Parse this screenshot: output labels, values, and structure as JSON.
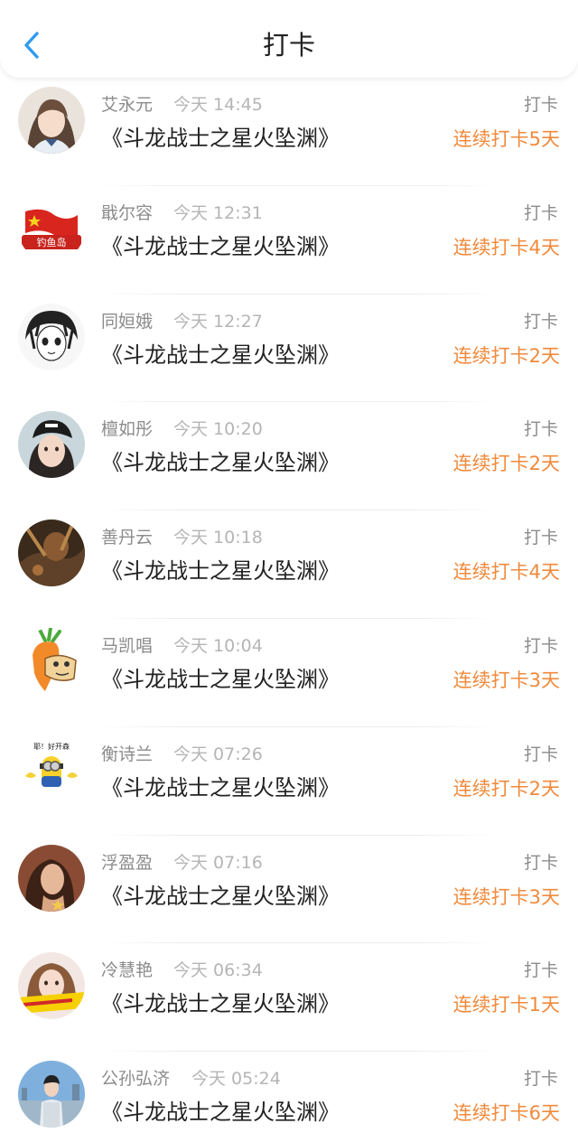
{
  "header": {
    "title": "打卡",
    "back_icon": "chevron-left-icon"
  },
  "colors": {
    "accent": "#2f9bf0",
    "streak": "#f08a3c",
    "muted": "#8c8c8c"
  },
  "checkins": [
    {
      "name": "艾永元",
      "time": "今天 14:45",
      "book": "《斗龙战士之星火坠渊》",
      "action": "打卡",
      "streak": "连续打卡5天",
      "avatar": "girl-portrait-avatar"
    },
    {
      "name": "戢尔容",
      "time": "今天 12:31",
      "book": "《斗龙战士之星火坠渊》",
      "action": "打卡",
      "streak": "连续打卡4天",
      "avatar": "flag-avatar",
      "avatar_text": "钓鱼岛"
    },
    {
      "name": "同姮娥",
      "time": "今天 12:27",
      "book": "《斗龙战士之星火坠渊》",
      "action": "打卡",
      "streak": "连续打卡2天",
      "avatar": "manga-avatar"
    },
    {
      "name": "檀如彤",
      "time": "今天 10:20",
      "book": "《斗龙战士之星火坠渊》",
      "action": "打卡",
      "streak": "连续打卡2天",
      "avatar": "girl-cap-avatar"
    },
    {
      "name": "善丹云",
      "time": "今天 10:18",
      "book": "《斗龙战士之星火坠渊》",
      "action": "打卡",
      "streak": "连续打卡4天",
      "avatar": "dark-scene-avatar"
    },
    {
      "name": "马凯唱",
      "time": "今天 10:04",
      "book": "《斗龙战士之星火坠渊》",
      "action": "打卡",
      "streak": "连续打卡3天",
      "avatar": "carrot-cartoon-avatar"
    },
    {
      "name": "衡诗兰",
      "time": "今天 07:26",
      "book": "《斗龙战士之星火坠渊》",
      "action": "打卡",
      "streak": "连续打卡2天",
      "avatar": "minion-avatar",
      "avatar_text": "耶！好开森"
    },
    {
      "name": "浮盈盈",
      "time": "今天 07:16",
      "book": "《斗龙战士之星火坠渊》",
      "action": "打卡",
      "streak": "连续打卡3天",
      "avatar": "woman-star-avatar"
    },
    {
      "name": "冷慧艳",
      "time": "今天 06:34",
      "book": "《斗龙战士之星火坠渊》",
      "action": "打卡",
      "streak": "连续打卡1天",
      "avatar": "woman-banner-avatar"
    },
    {
      "name": "公孙弘济",
      "time": "今天 05:24",
      "book": "《斗龙战士之星火坠渊》",
      "action": "打卡",
      "streak": "连续打卡6天",
      "avatar": "man-city-avatar"
    }
  ]
}
